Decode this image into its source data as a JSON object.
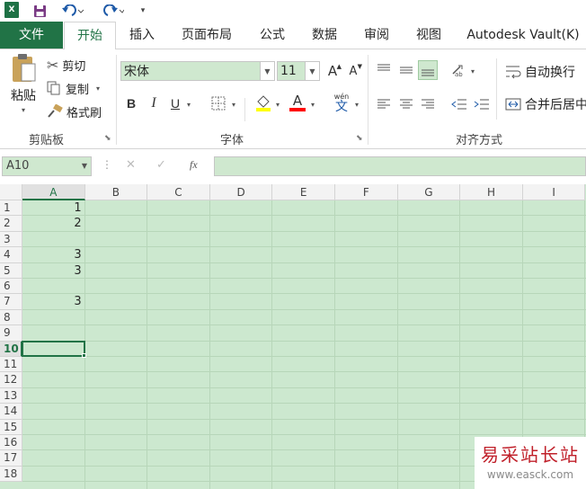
{
  "qat": {
    "logo_text": "X",
    "undo_icon": "undo-icon",
    "redo_icon": "redo-icon",
    "save_icon": "save-icon"
  },
  "tabs": {
    "file": "文件",
    "home": "开始",
    "insert": "插入",
    "layout": "页面布局",
    "formulas": "公式",
    "data": "数据",
    "review": "审阅",
    "view": "视图",
    "vault": "Autodesk Vault(K)"
  },
  "clipboard": {
    "paste": "粘贴",
    "cut": "剪切",
    "copy": "复制",
    "painter": "格式刷",
    "label": "剪贴板"
  },
  "font": {
    "name": "宋体",
    "size": "11",
    "grow": "A",
    "shrink": "A",
    "bold": "B",
    "italic": "I",
    "underline": "U",
    "color_letter": "A",
    "phonetic_top": "wén",
    "phonetic_char": "文",
    "label": "字体"
  },
  "alignment": {
    "wrap": "自动换行",
    "merge": "合并后居中",
    "label": "对齐方式"
  },
  "formula_bar": {
    "name_box": "A10",
    "fx": "fx",
    "cancel": "✕",
    "enter": "✓"
  },
  "grid": {
    "columns": [
      "A",
      "B",
      "C",
      "D",
      "E",
      "F",
      "G",
      "H",
      "I"
    ],
    "rows": [
      "1",
      "2",
      "3",
      "4",
      "5",
      "6",
      "7",
      "8",
      "9",
      "10",
      "11",
      "12",
      "13",
      "14",
      "15",
      "16",
      "17",
      "18"
    ],
    "selected_cell": "A10",
    "cells": {
      "A1": "1",
      "A2": "2",
      "A4": "3",
      "A5": "3",
      "A7": "3"
    }
  },
  "watermark": {
    "title": "易采站长站",
    "url": "www.easck.com"
  },
  "colors": {
    "accent": "#217346",
    "cell_bg": "#cce8cf"
  }
}
